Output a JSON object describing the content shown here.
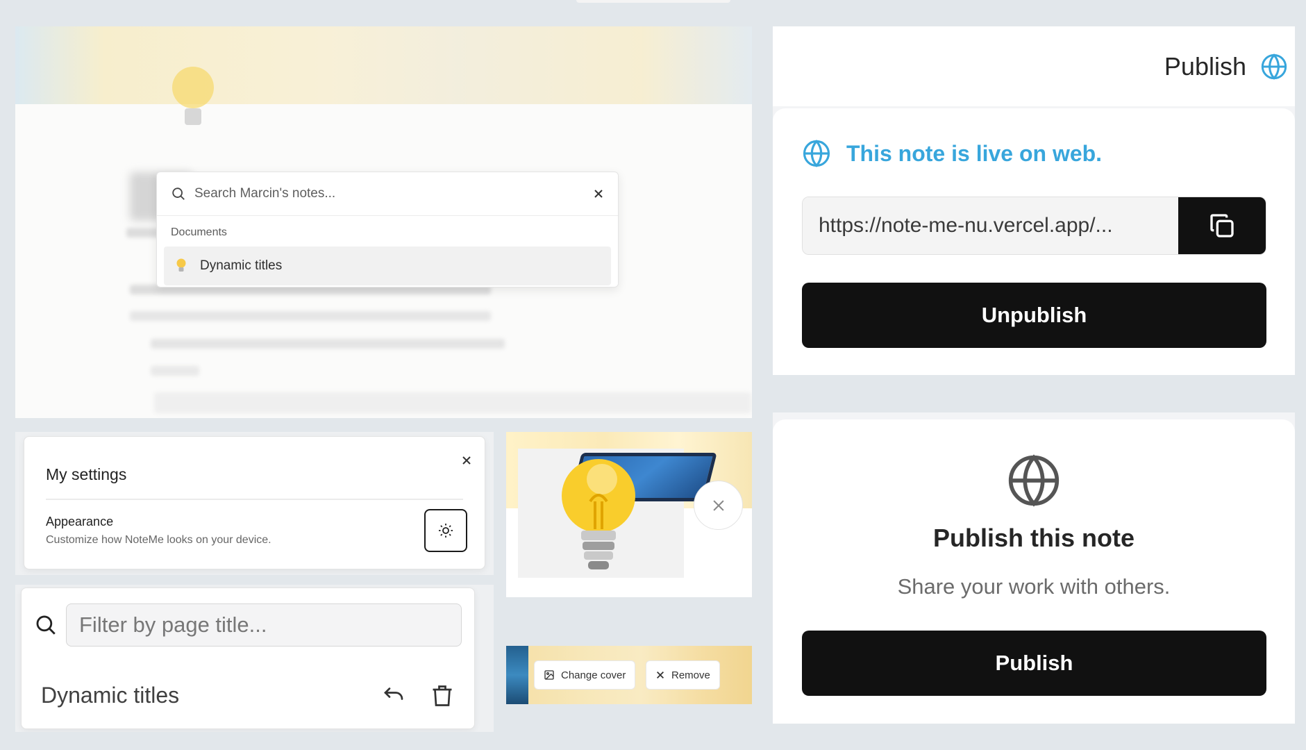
{
  "search_panel": {
    "placeholder": "Search Marcin's notes...",
    "section_label": "Documents",
    "results": [
      {
        "emoji": "lightbulb-icon",
        "title": "Dynamic titles"
      }
    ]
  },
  "publish_live": {
    "header_label": "Publish",
    "live_message": "This note is live on web.",
    "url": "https://note-me-nu.vercel.app/...",
    "unpublish_label": "Unpublish"
  },
  "settings": {
    "title": "My settings",
    "appearance_label": "Appearance",
    "appearance_desc": "Customize how NoteMe looks on your device."
  },
  "filter_panel": {
    "placeholder": "Filter by page title...",
    "items": [
      {
        "title": "Dynamic titles"
      }
    ]
  },
  "cover_actions": {
    "change_label": "Change cover",
    "remove_label": "Remove"
  },
  "publish_new": {
    "heading": "Publish this note",
    "subtext": "Share your work with others.",
    "button_label": "Publish"
  },
  "colors": {
    "accent_blue": "#38a6dc",
    "button_black": "#111111",
    "page_bg": "#e2e7eb"
  }
}
